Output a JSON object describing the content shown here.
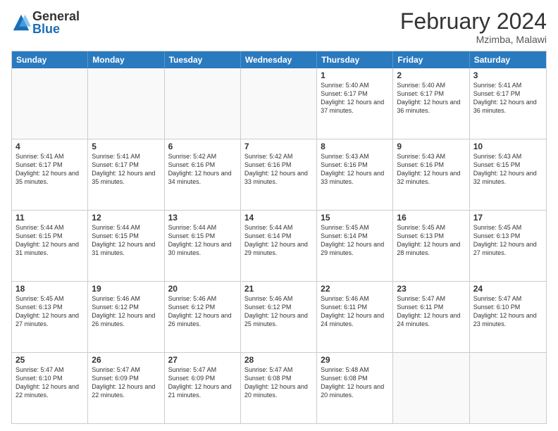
{
  "logo": {
    "general": "General",
    "blue": "Blue"
  },
  "title": {
    "month_year": "February 2024",
    "location": "Mzimba, Malawi"
  },
  "weekdays": [
    "Sunday",
    "Monday",
    "Tuesday",
    "Wednesday",
    "Thursday",
    "Friday",
    "Saturday"
  ],
  "weeks": [
    [
      {
        "day": "",
        "info": ""
      },
      {
        "day": "",
        "info": ""
      },
      {
        "day": "",
        "info": ""
      },
      {
        "day": "",
        "info": ""
      },
      {
        "day": "1",
        "info": "Sunrise: 5:40 AM\nSunset: 6:17 PM\nDaylight: 12 hours\nand 37 minutes."
      },
      {
        "day": "2",
        "info": "Sunrise: 5:40 AM\nSunset: 6:17 PM\nDaylight: 12 hours\nand 36 minutes."
      },
      {
        "day": "3",
        "info": "Sunrise: 5:41 AM\nSunset: 6:17 PM\nDaylight: 12 hours\nand 36 minutes."
      }
    ],
    [
      {
        "day": "4",
        "info": "Sunrise: 5:41 AM\nSunset: 6:17 PM\nDaylight: 12 hours\nand 35 minutes."
      },
      {
        "day": "5",
        "info": "Sunrise: 5:41 AM\nSunset: 6:17 PM\nDaylight: 12 hours\nand 35 minutes."
      },
      {
        "day": "6",
        "info": "Sunrise: 5:42 AM\nSunset: 6:16 PM\nDaylight: 12 hours\nand 34 minutes."
      },
      {
        "day": "7",
        "info": "Sunrise: 5:42 AM\nSunset: 6:16 PM\nDaylight: 12 hours\nand 33 minutes."
      },
      {
        "day": "8",
        "info": "Sunrise: 5:43 AM\nSunset: 6:16 PM\nDaylight: 12 hours\nand 33 minutes."
      },
      {
        "day": "9",
        "info": "Sunrise: 5:43 AM\nSunset: 6:16 PM\nDaylight: 12 hours\nand 32 minutes."
      },
      {
        "day": "10",
        "info": "Sunrise: 5:43 AM\nSunset: 6:15 PM\nDaylight: 12 hours\nand 32 minutes."
      }
    ],
    [
      {
        "day": "11",
        "info": "Sunrise: 5:44 AM\nSunset: 6:15 PM\nDaylight: 12 hours\nand 31 minutes."
      },
      {
        "day": "12",
        "info": "Sunrise: 5:44 AM\nSunset: 6:15 PM\nDaylight: 12 hours\nand 31 minutes."
      },
      {
        "day": "13",
        "info": "Sunrise: 5:44 AM\nSunset: 6:15 PM\nDaylight: 12 hours\nand 30 minutes."
      },
      {
        "day": "14",
        "info": "Sunrise: 5:44 AM\nSunset: 6:14 PM\nDaylight: 12 hours\nand 29 minutes."
      },
      {
        "day": "15",
        "info": "Sunrise: 5:45 AM\nSunset: 6:14 PM\nDaylight: 12 hours\nand 29 minutes."
      },
      {
        "day": "16",
        "info": "Sunrise: 5:45 AM\nSunset: 6:13 PM\nDaylight: 12 hours\nand 28 minutes."
      },
      {
        "day": "17",
        "info": "Sunrise: 5:45 AM\nSunset: 6:13 PM\nDaylight: 12 hours\nand 27 minutes."
      }
    ],
    [
      {
        "day": "18",
        "info": "Sunrise: 5:45 AM\nSunset: 6:13 PM\nDaylight: 12 hours\nand 27 minutes."
      },
      {
        "day": "19",
        "info": "Sunrise: 5:46 AM\nSunset: 6:12 PM\nDaylight: 12 hours\nand 26 minutes."
      },
      {
        "day": "20",
        "info": "Sunrise: 5:46 AM\nSunset: 6:12 PM\nDaylight: 12 hours\nand 26 minutes."
      },
      {
        "day": "21",
        "info": "Sunrise: 5:46 AM\nSunset: 6:12 PM\nDaylight: 12 hours\nand 25 minutes."
      },
      {
        "day": "22",
        "info": "Sunrise: 5:46 AM\nSunset: 6:11 PM\nDaylight: 12 hours\nand 24 minutes."
      },
      {
        "day": "23",
        "info": "Sunrise: 5:47 AM\nSunset: 6:11 PM\nDaylight: 12 hours\nand 24 minutes."
      },
      {
        "day": "24",
        "info": "Sunrise: 5:47 AM\nSunset: 6:10 PM\nDaylight: 12 hours\nand 23 minutes."
      }
    ],
    [
      {
        "day": "25",
        "info": "Sunrise: 5:47 AM\nSunset: 6:10 PM\nDaylight: 12 hours\nand 22 minutes."
      },
      {
        "day": "26",
        "info": "Sunrise: 5:47 AM\nSunset: 6:09 PM\nDaylight: 12 hours\nand 22 minutes."
      },
      {
        "day": "27",
        "info": "Sunrise: 5:47 AM\nSunset: 6:09 PM\nDaylight: 12 hours\nand 21 minutes."
      },
      {
        "day": "28",
        "info": "Sunrise: 5:47 AM\nSunset: 6:08 PM\nDaylight: 12 hours\nand 20 minutes."
      },
      {
        "day": "29",
        "info": "Sunrise: 5:48 AM\nSunset: 6:08 PM\nDaylight: 12 hours\nand 20 minutes."
      },
      {
        "day": "",
        "info": ""
      },
      {
        "day": "",
        "info": ""
      }
    ]
  ]
}
